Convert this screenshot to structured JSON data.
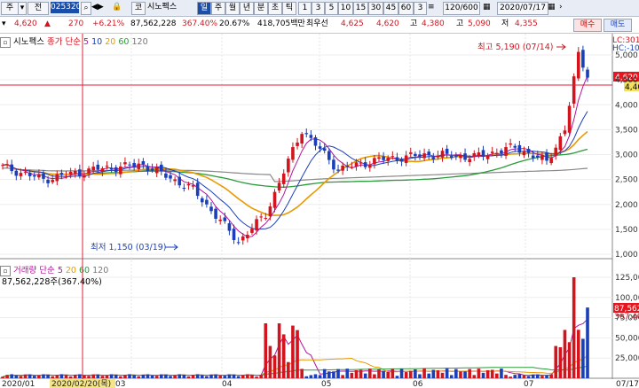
{
  "toolbar": {
    "market": "주",
    "period_select": "전",
    "code": "025320",
    "market2": "코",
    "name": "시노펙스",
    "selected_period": "일",
    "periods": [
      "주",
      "월",
      "년",
      "분",
      "초",
      "틱"
    ],
    "minutes": [
      "1",
      "3",
      "5",
      "10",
      "15",
      "30",
      "45",
      "60",
      "3"
    ],
    "view_count": "120/600",
    "date": "2020/07/17",
    "buy_label": "매수",
    "sell_label": "매도"
  },
  "info": {
    "price": "4,620",
    "arrow": "▲",
    "change": "270",
    "change_pct": "+6.21%",
    "volume": "87,562,228",
    "vol_ratio": "367.40%",
    "turnover_rate": "20.67%",
    "amount": "418,705백만",
    "best_ask_label": "최우선",
    "best_ask": "4,625",
    "best_bid": "4,620",
    "high_label": "고",
    "high": "4,380",
    "low_label": "고",
    "low": "5,090",
    "low2_label": "저",
    "low2": "4,355"
  },
  "price_panel": {
    "title": "시노펙스",
    "legend": [
      {
        "label": "종가 단순",
        "color": "#d2141e"
      },
      {
        "label": "5",
        "color": "#b0159a"
      },
      {
        "label": "10",
        "color": "#1a3fb8"
      },
      {
        "label": "20",
        "color": "#e89a00"
      },
      {
        "label": "60",
        "color": "#2a9a3a"
      },
      {
        "label": "120",
        "color": "#777777"
      }
    ],
    "max_annotation": "최고 5,190 (07/14)",
    "min_annotation": "최저 1,150 (03/19)",
    "lc_label": "LC:301",
    "hc_label": "HC:-10",
    "current_price_tag": "4,620",
    "secondary_tag": "4,40",
    "y_ticks": [
      "5,000",
      "4,500",
      "4,000",
      "3,500",
      "3,000",
      "2,500",
      "2,000",
      "1,500",
      "1,000"
    ]
  },
  "volume_panel": {
    "title": "거래량",
    "legend": [
      {
        "label": "단순",
        "color": "#b0159a"
      },
      {
        "label": "5",
        "color": "#b0159a"
      },
      {
        "label": "20",
        "color": "#e89a00"
      },
      {
        "label": "60",
        "color": "#2a9a3a"
      },
      {
        "label": "120",
        "color": "#777777"
      }
    ],
    "value_text": "87,562,228주(367.40%)",
    "current_tag": "87,562",
    "ratio_tag": "367.40",
    "y_ticks": [
      "125,000",
      "100,000",
      "75,000",
      "50,000",
      "25,000"
    ]
  },
  "x_axis": {
    "labels": [
      "2020/01",
      "2020/02/20(목)",
      "03",
      "04",
      "05",
      "06",
      "07",
      "07/17"
    ]
  },
  "colors": {
    "up": "#d2141e",
    "down": "#1a3fb8",
    "crosshair": "#e0203a"
  },
  "chart_data": [
    {
      "type": "line",
      "title": "시노펙스",
      "note": "daily candles, values approximate",
      "x": [
        "2020-01-02",
        "2020-01-15",
        "2020-02-03",
        "2020-02-20",
        "2020-03-05",
        "2020-03-19",
        "2020-03-27",
        "2020-04-08",
        "2020-04-20",
        "2020-05-04",
        "2020-05-20",
        "2020-06-03",
        "2020-06-17",
        "2020-07-01",
        "2020-07-08",
        "2020-07-14",
        "2020-07-17"
      ],
      "series": [
        {
          "name": "종가",
          "values": [
            2750,
            2500,
            2700,
            2800,
            2300,
            1250,
            1800,
            3500,
            2700,
            2900,
            3000,
            2950,
            3150,
            2850,
            3500,
            5000,
            4620
          ]
        }
      ],
      "ylim": [
        900,
        5200
      ]
    },
    {
      "type": "bar",
      "title": "거래량",
      "x": [
        "2020-01",
        "2020-02",
        "2020-03",
        "2020-04-02",
        "2020-04-08",
        "2020-05",
        "2020-06",
        "2020-07-08",
        "2020-07-14",
        "2020-07-17"
      ],
      "series": [
        {
          "name": "거래량",
          "values": [
            2000,
            3000,
            4000,
            40000,
            70000,
            10000,
            8000,
            60000,
            125000,
            87562
          ]
        }
      ]
    }
  ]
}
